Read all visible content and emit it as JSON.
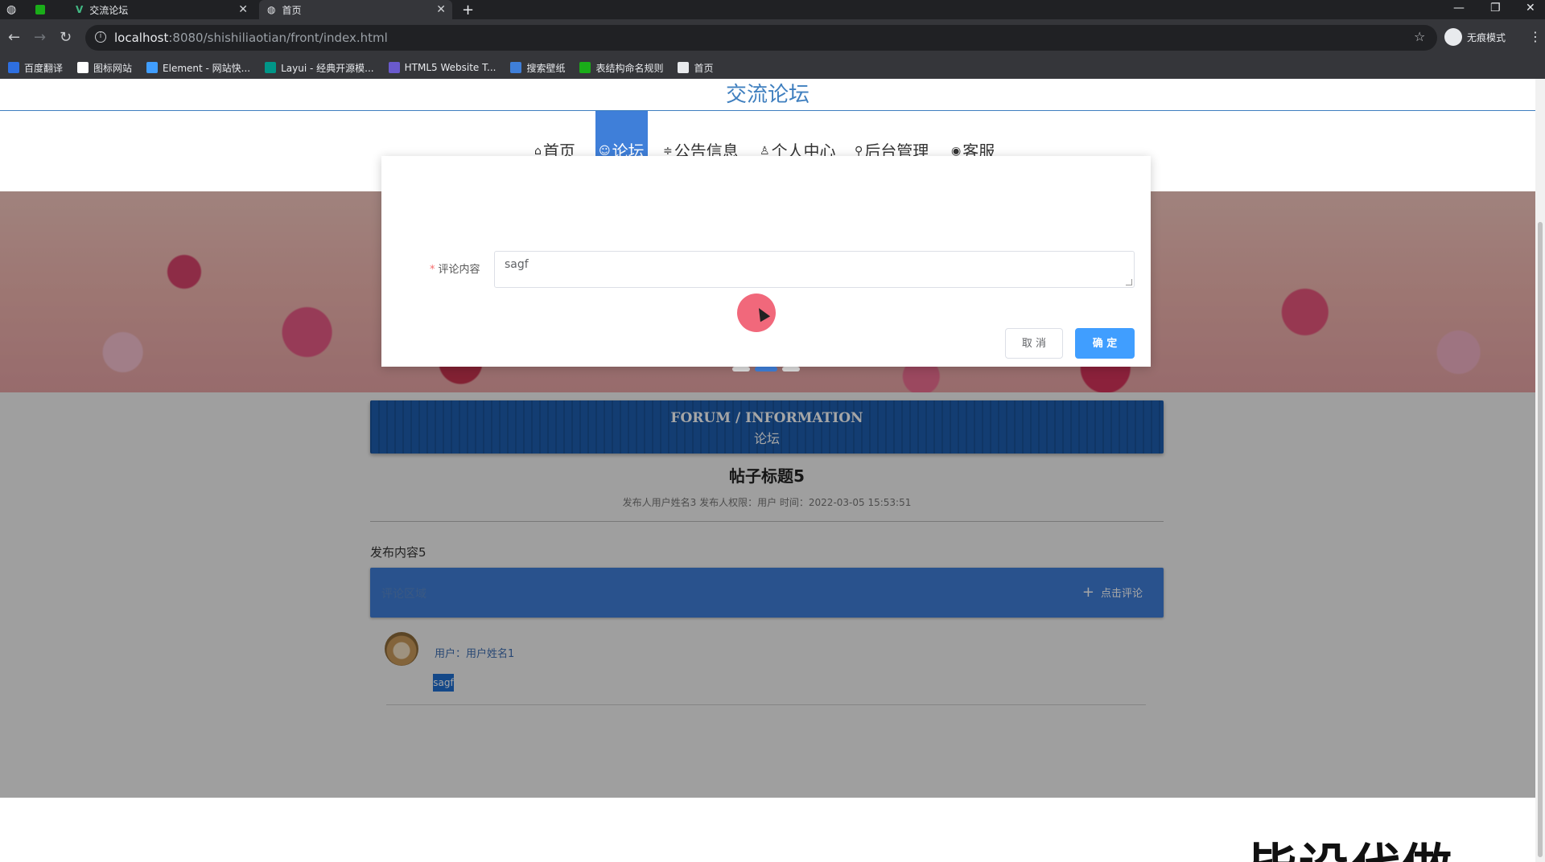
{
  "browser": {
    "tabs": [
      {
        "label": "交流论坛"
      },
      {
        "label": "首页"
      }
    ],
    "url_host": "localhost",
    "url_path": ":8080/shishiliaotian/front/index.html",
    "incognito_label": "无痕模式",
    "bookmarks": [
      {
        "label": "百度翻译",
        "color": "#2e6fe0"
      },
      {
        "label": "图标网站",
        "color": "#ffffff"
      },
      {
        "label": "Element - 网站快...",
        "color": "#409eff"
      },
      {
        "label": "Layui - 经典开源模...",
        "color": "#009688"
      },
      {
        "label": "HTML5 Website T...",
        "color": "#6a5acd"
      },
      {
        "label": "搜索壁纸",
        "color": "#3f7fd9"
      },
      {
        "label": "表结构命名规则",
        "color": "#1aad19"
      },
      {
        "label": "首页",
        "color": "#e8eaed"
      }
    ]
  },
  "site": {
    "title": "交流论坛",
    "nav": [
      {
        "label": "首页",
        "icon": "home-icon",
        "glyph": "⌂"
      },
      {
        "label": "论坛",
        "icon": "forum-icon",
        "glyph": "☺"
      },
      {
        "label": "公告信息",
        "icon": "notice-icon",
        "glyph": "≑"
      },
      {
        "label": "个人中心",
        "icon": "user-icon",
        "glyph": "♙"
      },
      {
        "label": "后台管理",
        "icon": "link-icon",
        "glyph": "⚲"
      },
      {
        "label": "客服",
        "icon": "service-icon",
        "glyph": "◉"
      }
    ],
    "active_nav": "论坛"
  },
  "dialog": {
    "field_label": "评论内容",
    "field_value": "sagf",
    "cancel_label": "取 消",
    "ok_label": "确 定"
  },
  "forum": {
    "heading_en": "FORUM / INFORMATION",
    "heading_cn": "论坛",
    "post_title": "帖子标题5",
    "post_meta": "发布人用户姓名3   发布人权限：用户   时间：2022-03-05 15:53:51",
    "post_content": "发布内容5",
    "comment_bar_label": "评论区域",
    "add_comment_label": "点击评论",
    "comments": [
      {
        "user": "用户：用户姓名1",
        "content": "sagf"
      }
    ]
  },
  "watermark": "毕设代做",
  "colors": {
    "accent": "#3f7fd9",
    "primary_button": "#409eff",
    "forum_header": "#1e5fb0"
  }
}
